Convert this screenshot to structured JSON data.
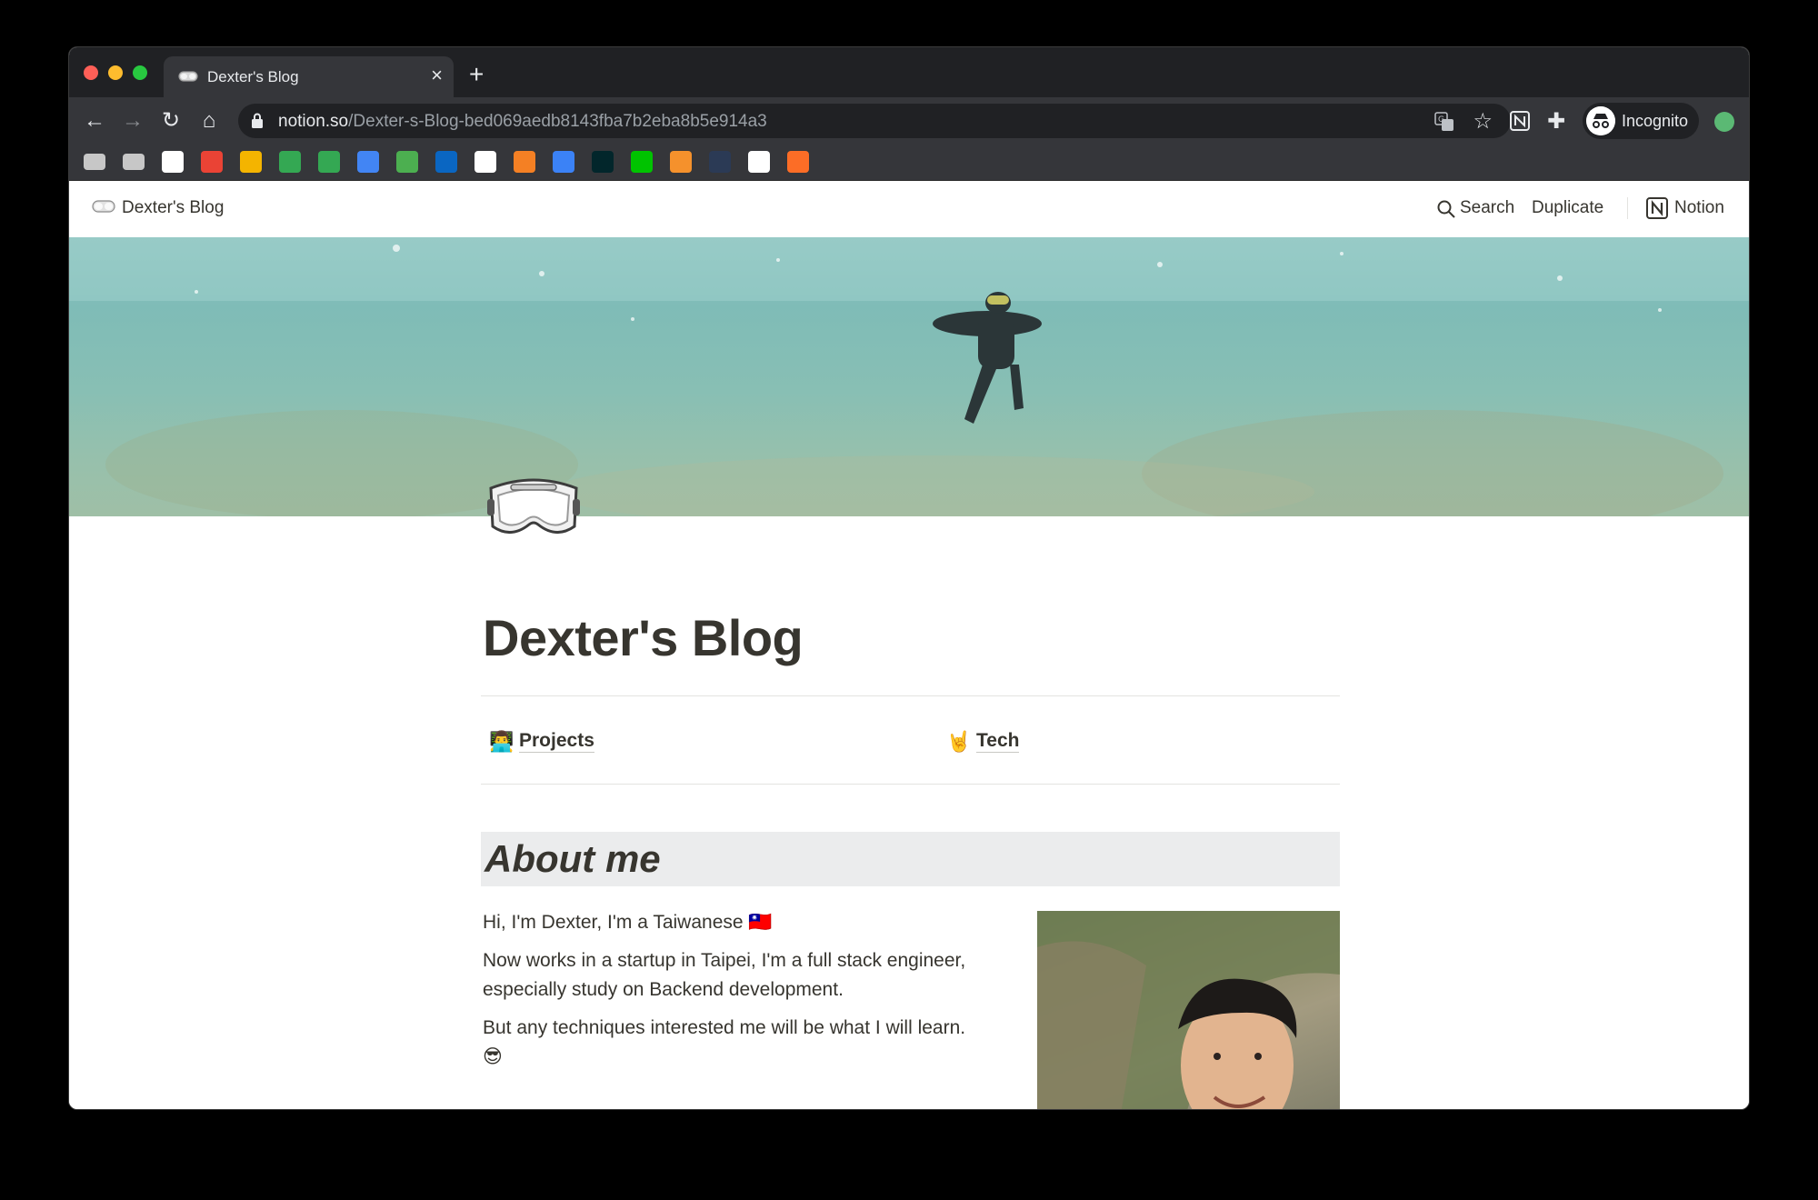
{
  "browser": {
    "tab_title": "Dexter's Blog",
    "tab_close": "×",
    "new_tab": "+",
    "url_host": "notion.so",
    "url_path": "/Dexter-s-Blog-bed069aedb8143fba7b2eba8b5e914a3",
    "incognito_label": "Incognito",
    "back": "←",
    "forward": "→",
    "reload": "↻",
    "home": "⌂",
    "star": "☆",
    "puzzle": "✚",
    "bookmarks": [
      {
        "icon": "folder-icon",
        "color": "#c7c7c7"
      },
      {
        "icon": "folder-icon",
        "color": "#c7c7c7"
      },
      {
        "icon": "notion-icon",
        "color": "#ffffff"
      },
      {
        "icon": "gmail-icon",
        "color": "#ea4335"
      },
      {
        "icon": "keep-icon",
        "color": "#f4b400"
      },
      {
        "icon": "drive-icon",
        "color": "#34a853"
      },
      {
        "icon": "maps-icon",
        "color": "#34a853"
      },
      {
        "icon": "translate-icon",
        "color": "#4285f4"
      },
      {
        "icon": "l-icon",
        "color": "#4caf50"
      },
      {
        "icon": "linkedin-icon",
        "color": "#0a66c2"
      },
      {
        "icon": "github-icon",
        "color": "#ffffff"
      },
      {
        "icon": "stackoverflow-icon",
        "color": "#f48024"
      },
      {
        "icon": "infinity-icon",
        "color": "#3b82f6"
      },
      {
        "icon": "edx-icon",
        "color": "#02262b"
      },
      {
        "icon": "line-icon",
        "color": "#00c300"
      },
      {
        "icon": "box-icon",
        "color": "#f5912c"
      },
      {
        "icon": "frs-icon",
        "color": "#2b3a55"
      },
      {
        "icon": "notion-icon",
        "color": "#ffffff"
      },
      {
        "icon": "gitlab-icon",
        "color": "#fc6d26"
      }
    ]
  },
  "notion": {
    "breadcrumb_title": "Dexter's Blog",
    "search_label": "Search",
    "duplicate_label": "Duplicate",
    "notion_label": "Notion",
    "page_title": "Dexter's Blog",
    "links": [
      {
        "emoji": "👨‍💻",
        "label": "Projects"
      },
      {
        "emoji": "🤘",
        "label": "Tech"
      }
    ],
    "about_heading": "About me",
    "bio": [
      "Hi, I'm Dexter, I'm a Taiwanese 🇹🇼",
      "Now works in a startup in Taipei, I'm a full stack engineer, especially study on Backend development.",
      "But any techniques interested me will be what I will learn. 😎"
    ]
  }
}
